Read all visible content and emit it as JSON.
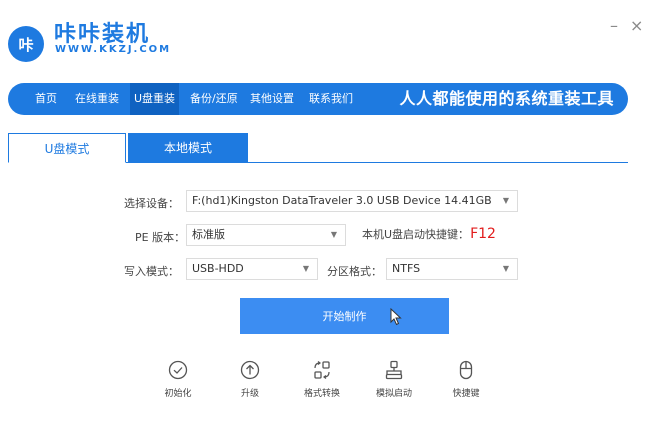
{
  "app": {
    "logo_text": "咔",
    "title": "咔咔装机",
    "subtitle": "WWW.KKZJ.COM",
    "brand_color": "#1E7AE0"
  },
  "window": {
    "minimize": "–",
    "close": "×"
  },
  "nav": {
    "items": [
      "首页",
      "在线重装",
      "U盘重装",
      "备份/还原",
      "其他设置",
      "联系我们"
    ],
    "active": "U盘重装",
    "slogan": "人人都能使用的系统重装工具"
  },
  "tabs": [
    {
      "label": "U盘模式",
      "active": true
    },
    {
      "label": "本地模式",
      "active": false
    }
  ],
  "form": {
    "device_label": "选择设备：",
    "device_value": "F:(hd1)Kingston DataTraveler 3.0 USB Device 14.41GB",
    "pe_label": "PE 版本：",
    "pe_value": "标准版",
    "hotkey_label": "本机U盘启动快捷键：",
    "hotkey_value": "F12",
    "write_label": "写入模式：",
    "write_value": "USB-HDD",
    "partition_label": "分区格式：",
    "partition_value": "NTFS",
    "caret": "▼"
  },
  "start_button": "开始制作",
  "tools": [
    {
      "label": "初始化",
      "icon": "check-circle-icon"
    },
    {
      "label": "升级",
      "icon": "upgrade-icon"
    },
    {
      "label": "格式转换",
      "icon": "convert-icon"
    },
    {
      "label": "模拟启动",
      "icon": "simulate-icon"
    },
    {
      "label": "快捷键",
      "icon": "mouse-icon"
    }
  ]
}
